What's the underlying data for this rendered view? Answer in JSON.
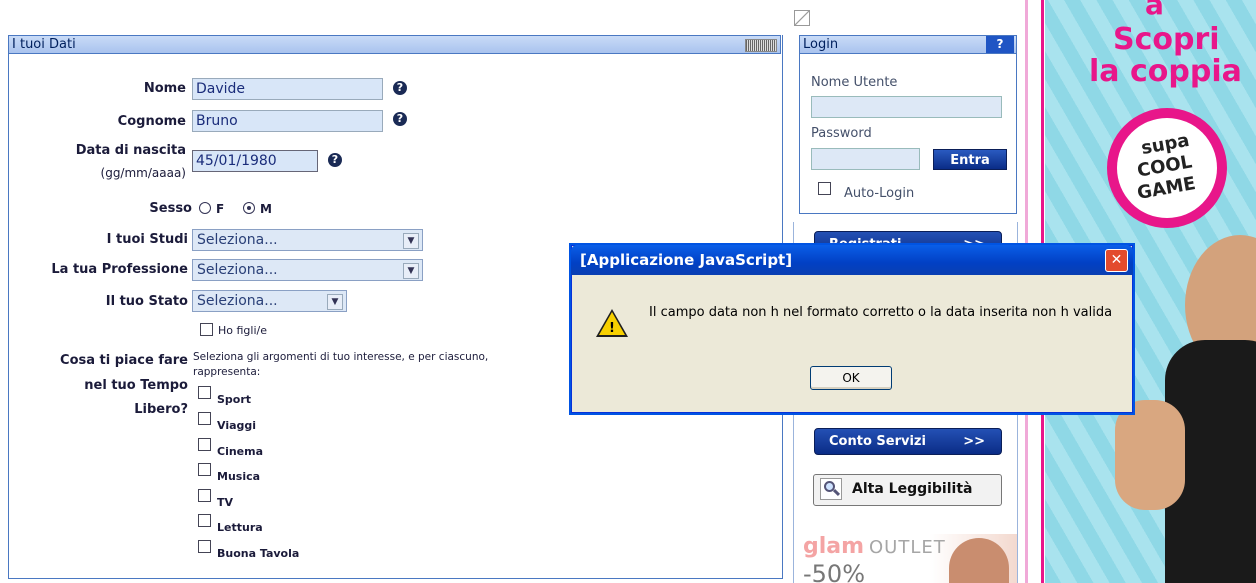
{
  "form_panel": {
    "title": "I tuoi Dati",
    "fields": {
      "nome": {
        "label": "Nome",
        "value": "Davide"
      },
      "cognome": {
        "label": "Cognome",
        "value": "Bruno"
      },
      "data_nascita": {
        "label": "Data di nascita",
        "hint": "(gg/mm/aaaa)",
        "value": "45/01/1980"
      },
      "sesso": {
        "label": "Sesso",
        "option_f": "F",
        "option_m": "M",
        "selected": "M"
      },
      "studi": {
        "label": "I tuoi Studi",
        "value": "Seleziona..."
      },
      "professione": {
        "label": "La tua Professione",
        "value": "Seleziona..."
      },
      "stato": {
        "label": "Il tuo Stato",
        "value": "Seleziona..."
      },
      "figli": {
        "label": "Ho figli/e"
      }
    },
    "tempo_libero": {
      "label_line1": "Cosa ti piace fare",
      "label_line2": "nel tuo Tempo",
      "label_line3": "Libero?",
      "intro_line1": "Seleziona gli argomenti di tuo interesse, e per ciascuno,",
      "intro_line2": "rappresenta:",
      "options": [
        "Sport",
        "Viaggi",
        "Cinema",
        "Musica",
        "TV",
        "Lettura",
        "Buona Tavola"
      ]
    },
    "help_glyph": "?"
  },
  "login": {
    "title": "Login",
    "help_glyph": "?",
    "username_label": "Nome Utente",
    "password_label": "Password",
    "submit": "Entra",
    "auto_login": "Auto-Login"
  },
  "side_buttons": {
    "registrati": "Registrati",
    "conto_servizi": "Conto Servizi",
    "arrow": ">>",
    "alta_leggibilita": "Alta Leggibilità"
  },
  "ad_banner": {
    "line1": "a",
    "line2": "Scopri",
    "line3": "la coppia",
    "bubble1": "supa",
    "bubble2": "COOL",
    "bubble3": "GAME"
  },
  "outlet_ad": {
    "brand": "glam",
    "word": "OUTLET",
    "discount": "-50%"
  },
  "dialog": {
    "title": "[Applicazione JavaScript]",
    "message": "Il campo data non h nel formato corretto o la data inserita non h valida",
    "ok": "OK",
    "close_glyph": "✕",
    "warn_glyph": "!"
  },
  "colors": {
    "panel_border": "#4a78c2",
    "button_blue": "#0a2c86",
    "ad_pink": "#e8168a",
    "ad_blue": "#8fd8e6"
  }
}
